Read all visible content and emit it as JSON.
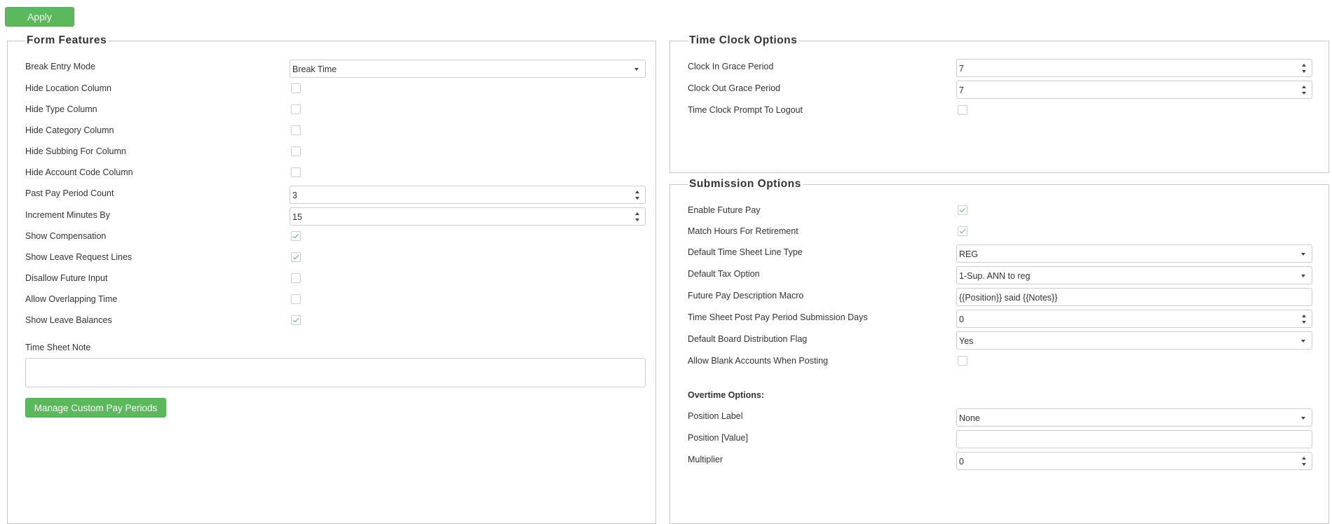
{
  "toolbar": {
    "apply_label": "Apply"
  },
  "form_features": {
    "title": "Form Features",
    "break_entry_mode": {
      "label": "Break Entry Mode",
      "value": "Break Time"
    },
    "hide_location_column": {
      "label": "Hide Location Column",
      "checked": false
    },
    "hide_type_column": {
      "label": "Hide Type Column",
      "checked": false
    },
    "hide_category_column": {
      "label": "Hide Category Column",
      "checked": false
    },
    "hide_subbing_for_column": {
      "label": "Hide Subbing For Column",
      "checked": false
    },
    "hide_account_code_column": {
      "label": "Hide Account Code Column",
      "checked": false
    },
    "past_pay_period_count": {
      "label": "Past Pay Period Count",
      "value": "3"
    },
    "increment_minutes_by": {
      "label": "Increment Minutes By",
      "value": "15"
    },
    "show_compensation": {
      "label": "Show Compensation",
      "checked": true
    },
    "show_leave_request_lines": {
      "label": "Show Leave Request Lines",
      "checked": true
    },
    "disallow_future_input": {
      "label": "Disallow Future Input",
      "checked": false
    },
    "allow_overlapping_time": {
      "label": "Allow Overlapping Time",
      "checked": false
    },
    "show_leave_balances": {
      "label": "Show Leave Balances",
      "checked": true
    },
    "time_sheet_note": {
      "label": "Time Sheet Note",
      "value": ""
    },
    "manage_custom_pay_periods_label": "Manage Custom Pay Periods"
  },
  "time_clock_options": {
    "title": "Time Clock Options",
    "clock_in_grace_period": {
      "label": "Clock In Grace Period",
      "value": "7"
    },
    "clock_out_grace_period": {
      "label": "Clock Out Grace Period",
      "value": "7"
    },
    "time_clock_prompt_to_logout": {
      "label": "Time Clock Prompt To Logout",
      "checked": false
    }
  },
  "submission_options": {
    "title": "Submission Options",
    "enable_future_pay": {
      "label": "Enable Future Pay",
      "checked": true
    },
    "match_hours_for_retirement": {
      "label": "Match Hours For Retirement",
      "checked": true
    },
    "default_time_sheet_line_type": {
      "label": "Default Time Sheet Line Type",
      "value": "REG"
    },
    "default_tax_option": {
      "label": "Default Tax Option",
      "value": "1-Sup. ANN to reg"
    },
    "future_pay_description_macro": {
      "label": "Future Pay Description Macro",
      "value": "{{Position}} said {{Notes}}"
    },
    "post_pay_period_submission_days": {
      "label": "Time Sheet Post Pay Period Submission Days",
      "value": "0"
    },
    "default_board_distribution_flag": {
      "label": "Default Board Distribution Flag",
      "value": "Yes"
    },
    "allow_blank_accounts_when_posting": {
      "label": "Allow Blank Accounts When Posting",
      "checked": false
    },
    "overtime_options": {
      "heading": "Overtime Options:",
      "position_label": {
        "label": "Position Label",
        "value": "None"
      },
      "position_value": {
        "label": "Position [Value]",
        "value": ""
      },
      "multiplier": {
        "label": "Multiplier",
        "value": "0"
      }
    }
  }
}
